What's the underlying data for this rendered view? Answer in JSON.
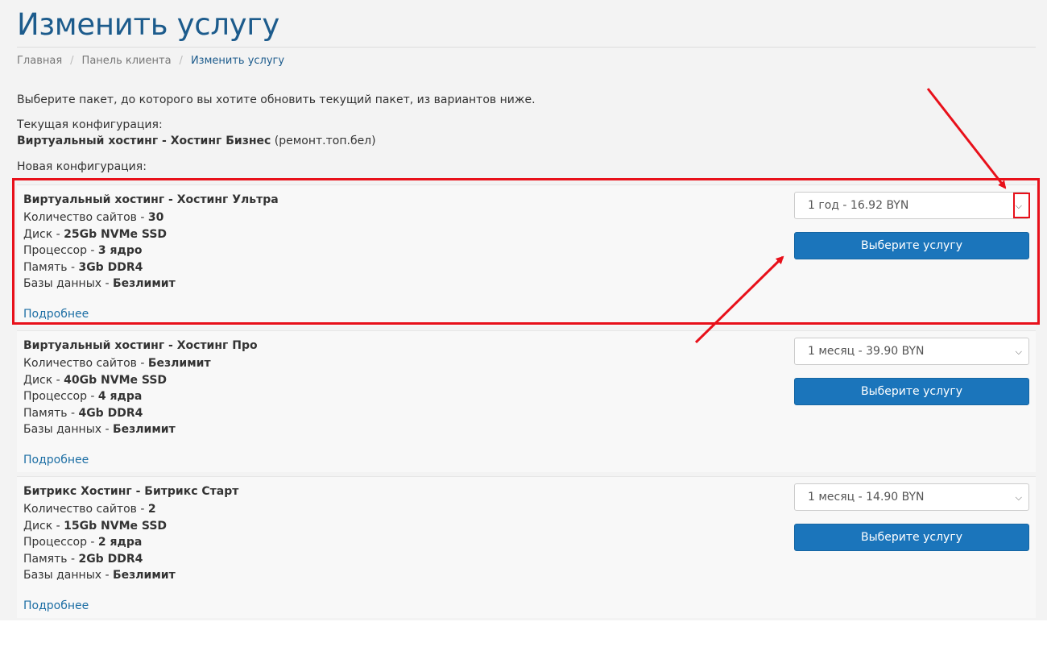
{
  "page": {
    "title": "Изменить услугу",
    "breadcrumb": [
      "Главная",
      "Панель клиента",
      "Изменить услугу"
    ],
    "intro": "Выберите пакет, до которого вы хотите обновить текущий пакет, из вариантов ниже.",
    "current_label": "Текущая конфигурация:",
    "current_product": "Виртуальный хостинг - Хостинг Бизнес",
    "current_domain": "(ремонт.топ.бел)",
    "new_label": "Новая конфигурация:"
  },
  "packages": [
    {
      "name": "Виртуальный хостинг - Хостинг Ультра",
      "specs": [
        {
          "label": "Количество сайтов",
          "value": "30"
        },
        {
          "label": "Диск",
          "value": "25Gb NVMe SSD"
        },
        {
          "label": "Процессор",
          "value": "3 ядро"
        },
        {
          "label": "Память",
          "value": "3Gb DDR4"
        },
        {
          "label": "Базы данных",
          "value": "Безлимит"
        }
      ],
      "more": "Подробнее",
      "cycle": "1 год - 16.92 BYN",
      "button": "Выберите услугу"
    },
    {
      "name": "Виртуальный хостинг - Хостинг Про",
      "specs": [
        {
          "label": "Количество сайтов",
          "value": "Безлимит"
        },
        {
          "label": "Диск",
          "value": "40Gb NVMe SSD"
        },
        {
          "label": "Процессор",
          "value": "4 ядра"
        },
        {
          "label": "Память",
          "value": "4Gb DDR4"
        },
        {
          "label": "Базы данных",
          "value": "Безлимит"
        }
      ],
      "more": "Подробнее",
      "cycle": "1 месяц - 39.90 BYN",
      "button": "Выберите услугу"
    },
    {
      "name": "Битрикс Хостинг - Битрикс Старт",
      "specs": [
        {
          "label": "Количество сайтов",
          "value": "2"
        },
        {
          "label": "Диск",
          "value": "15Gb NVMe SSD"
        },
        {
          "label": "Процессор",
          "value": "2 ядра"
        },
        {
          "label": "Память",
          "value": "2Gb DDR4"
        },
        {
          "label": "Базы данных",
          "value": "Безлимит"
        }
      ],
      "more": "Подробнее",
      "cycle": "1 месяц - 14.90 BYN",
      "button": "Выберите услугу"
    }
  ],
  "icons": {
    "dropdown": "chevron-down-icon",
    "annotation_arrow": "red-arrow-icon"
  },
  "colors": {
    "title": "#1c5b8c",
    "link": "#1c6ea4",
    "button": "#1b75bb",
    "highlight": "#e8101a"
  }
}
